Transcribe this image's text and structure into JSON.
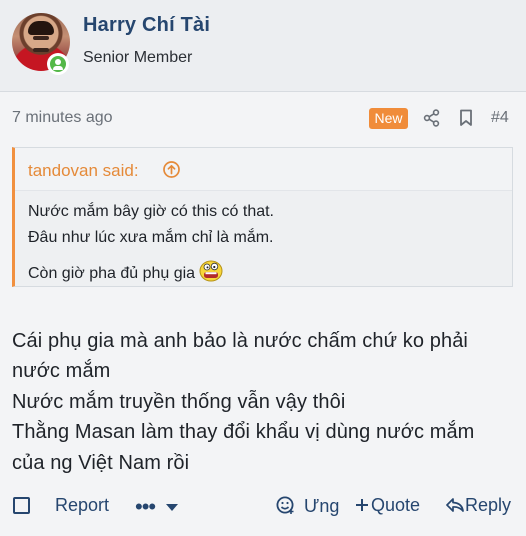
{
  "user": {
    "name": "Harry Chí Tài",
    "title": "Senior Member",
    "avatar_alt": "avatar"
  },
  "post": {
    "time": "7 minutes ago",
    "badge": "New",
    "number": "#4",
    "quote": {
      "author_label": "tandovan said:",
      "lines": [
        "Nước mắm bây giờ có this có that.",
        "Đâu như lúc xưa mắm chỉ là mắm.",
        "Còn giờ pha đủ phụ gia"
      ]
    },
    "body": [
      "Cái phụ gia mà anh bảo là nước chấm chứ ko phải",
      "nước mắm",
      "Nước mắm truyền thống vẫn vậy thôi",
      "Thằng Masan làm thay đổi khẩu vị dùng nước mắm",
      "của ng Việt Nam rồi"
    ]
  },
  "actions": {
    "report": "Report",
    "more": "•••",
    "react": "Ưng",
    "quote": "Quote",
    "reply": "Reply"
  },
  "colors": {
    "link": "#26466f",
    "accent": "#f08c3a",
    "online": "#54b848"
  },
  "icons": {
    "share": "share-icon",
    "bookmark": "bookmark-icon",
    "quote_up": "arrow-up-circle-icon",
    "react": "smile-icon",
    "plus": "plus-icon",
    "reply": "reply-icon"
  }
}
